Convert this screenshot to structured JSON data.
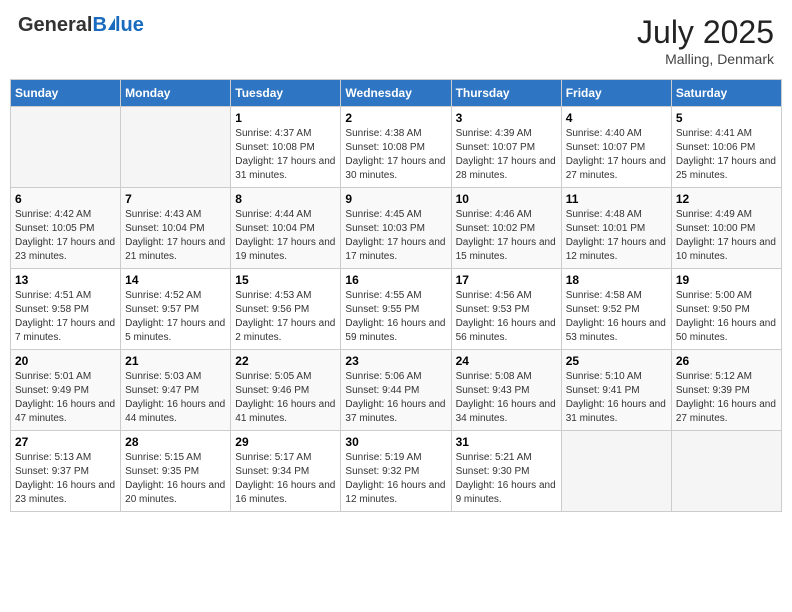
{
  "header": {
    "logo_general": "General",
    "logo_blue": "Blue",
    "month_year": "July 2025",
    "location": "Malling, Denmark"
  },
  "weekdays": [
    "Sunday",
    "Monday",
    "Tuesday",
    "Wednesday",
    "Thursday",
    "Friday",
    "Saturday"
  ],
  "weeks": [
    [
      {
        "day": "",
        "info": ""
      },
      {
        "day": "",
        "info": ""
      },
      {
        "day": "1",
        "info": "Sunrise: 4:37 AM\nSunset: 10:08 PM\nDaylight: 17 hours and 31 minutes."
      },
      {
        "day": "2",
        "info": "Sunrise: 4:38 AM\nSunset: 10:08 PM\nDaylight: 17 hours and 30 minutes."
      },
      {
        "day": "3",
        "info": "Sunrise: 4:39 AM\nSunset: 10:07 PM\nDaylight: 17 hours and 28 minutes."
      },
      {
        "day": "4",
        "info": "Sunrise: 4:40 AM\nSunset: 10:07 PM\nDaylight: 17 hours and 27 minutes."
      },
      {
        "day": "5",
        "info": "Sunrise: 4:41 AM\nSunset: 10:06 PM\nDaylight: 17 hours and 25 minutes."
      }
    ],
    [
      {
        "day": "6",
        "info": "Sunrise: 4:42 AM\nSunset: 10:05 PM\nDaylight: 17 hours and 23 minutes."
      },
      {
        "day": "7",
        "info": "Sunrise: 4:43 AM\nSunset: 10:04 PM\nDaylight: 17 hours and 21 minutes."
      },
      {
        "day": "8",
        "info": "Sunrise: 4:44 AM\nSunset: 10:04 PM\nDaylight: 17 hours and 19 minutes."
      },
      {
        "day": "9",
        "info": "Sunrise: 4:45 AM\nSunset: 10:03 PM\nDaylight: 17 hours and 17 minutes."
      },
      {
        "day": "10",
        "info": "Sunrise: 4:46 AM\nSunset: 10:02 PM\nDaylight: 17 hours and 15 minutes."
      },
      {
        "day": "11",
        "info": "Sunrise: 4:48 AM\nSunset: 10:01 PM\nDaylight: 17 hours and 12 minutes."
      },
      {
        "day": "12",
        "info": "Sunrise: 4:49 AM\nSunset: 10:00 PM\nDaylight: 17 hours and 10 minutes."
      }
    ],
    [
      {
        "day": "13",
        "info": "Sunrise: 4:51 AM\nSunset: 9:58 PM\nDaylight: 17 hours and 7 minutes."
      },
      {
        "day": "14",
        "info": "Sunrise: 4:52 AM\nSunset: 9:57 PM\nDaylight: 17 hours and 5 minutes."
      },
      {
        "day": "15",
        "info": "Sunrise: 4:53 AM\nSunset: 9:56 PM\nDaylight: 17 hours and 2 minutes."
      },
      {
        "day": "16",
        "info": "Sunrise: 4:55 AM\nSunset: 9:55 PM\nDaylight: 16 hours and 59 minutes."
      },
      {
        "day": "17",
        "info": "Sunrise: 4:56 AM\nSunset: 9:53 PM\nDaylight: 16 hours and 56 minutes."
      },
      {
        "day": "18",
        "info": "Sunrise: 4:58 AM\nSunset: 9:52 PM\nDaylight: 16 hours and 53 minutes."
      },
      {
        "day": "19",
        "info": "Sunrise: 5:00 AM\nSunset: 9:50 PM\nDaylight: 16 hours and 50 minutes."
      }
    ],
    [
      {
        "day": "20",
        "info": "Sunrise: 5:01 AM\nSunset: 9:49 PM\nDaylight: 16 hours and 47 minutes."
      },
      {
        "day": "21",
        "info": "Sunrise: 5:03 AM\nSunset: 9:47 PM\nDaylight: 16 hours and 44 minutes."
      },
      {
        "day": "22",
        "info": "Sunrise: 5:05 AM\nSunset: 9:46 PM\nDaylight: 16 hours and 41 minutes."
      },
      {
        "day": "23",
        "info": "Sunrise: 5:06 AM\nSunset: 9:44 PM\nDaylight: 16 hours and 37 minutes."
      },
      {
        "day": "24",
        "info": "Sunrise: 5:08 AM\nSunset: 9:43 PM\nDaylight: 16 hours and 34 minutes."
      },
      {
        "day": "25",
        "info": "Sunrise: 5:10 AM\nSunset: 9:41 PM\nDaylight: 16 hours and 31 minutes."
      },
      {
        "day": "26",
        "info": "Sunrise: 5:12 AM\nSunset: 9:39 PM\nDaylight: 16 hours and 27 minutes."
      }
    ],
    [
      {
        "day": "27",
        "info": "Sunrise: 5:13 AM\nSunset: 9:37 PM\nDaylight: 16 hours and 23 minutes."
      },
      {
        "day": "28",
        "info": "Sunrise: 5:15 AM\nSunset: 9:35 PM\nDaylight: 16 hours and 20 minutes."
      },
      {
        "day": "29",
        "info": "Sunrise: 5:17 AM\nSunset: 9:34 PM\nDaylight: 16 hours and 16 minutes."
      },
      {
        "day": "30",
        "info": "Sunrise: 5:19 AM\nSunset: 9:32 PM\nDaylight: 16 hours and 12 minutes."
      },
      {
        "day": "31",
        "info": "Sunrise: 5:21 AM\nSunset: 9:30 PM\nDaylight: 16 hours and 9 minutes."
      },
      {
        "day": "",
        "info": ""
      },
      {
        "day": "",
        "info": ""
      }
    ]
  ]
}
